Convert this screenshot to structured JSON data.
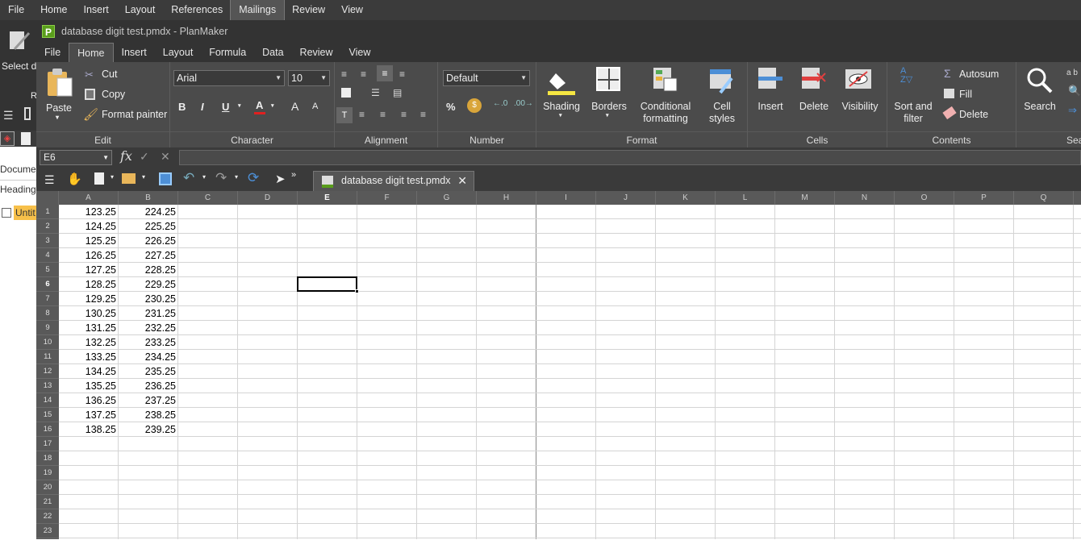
{
  "back_app": {
    "menu": [
      "File",
      "Home",
      "Insert",
      "Layout",
      "References",
      "Mailings",
      "Review",
      "View"
    ],
    "active_menu": "Mailings",
    "select_database": "Select database",
    "side_items": [
      "Documen",
      "Heading",
      "Untit"
    ]
  },
  "window": {
    "title": "database digit test.pmdx - PlanMaker",
    "app_icon": "P"
  },
  "menu": [
    "File",
    "Home",
    "Insert",
    "Layout",
    "Formula",
    "Data",
    "Review",
    "View"
  ],
  "active_menu": "Home",
  "ribbon": {
    "edit": {
      "label": "Edit",
      "paste": "Paste",
      "cut": "Cut",
      "copy": "Copy",
      "format_painter": "Format painter"
    },
    "character": {
      "label": "Character",
      "font": "Arial",
      "size": "10",
      "bold": "B",
      "italic": "I",
      "underline": "U",
      "font_color": "A",
      "grow": "A",
      "shrink": "A"
    },
    "alignment": {
      "label": "Alignment"
    },
    "number": {
      "label": "Number",
      "format": "Default",
      "percent": "%"
    },
    "format": {
      "label": "Format",
      "shading": "Shading",
      "borders": "Borders",
      "conditional": "Conditional formatting",
      "cell_styles": "Cell styles"
    },
    "cells": {
      "label": "Cells",
      "insert": "Insert",
      "delete": "Delete",
      "visibility": "Visibility"
    },
    "contents": {
      "label": "Contents",
      "sort": "Sort and filter",
      "autosum": "Autosum",
      "fill": "Fill",
      "delete": "Delete"
    },
    "search": {
      "label": "Sear",
      "search": "Search"
    }
  },
  "formula_bar": {
    "cell_ref": "E6",
    "fx": "fx",
    "value": ""
  },
  "doc_tab": "database digit test.pmdx",
  "columns": [
    "A",
    "B",
    "C",
    "D",
    "E",
    "F",
    "G",
    "H",
    "I",
    "J",
    "K",
    "L",
    "M",
    "N",
    "O",
    "P",
    "Q"
  ],
  "selected_column": "E",
  "selected_row": 6,
  "rows": [
    1,
    2,
    3,
    4,
    5,
    6,
    7,
    8,
    9,
    10,
    11,
    12,
    13,
    14,
    15,
    16,
    17,
    18,
    19,
    20,
    21,
    22,
    23
  ],
  "data": {
    "A": [
      "123.25",
      "124.25",
      "125.25",
      "126.25",
      "127.25",
      "128.25",
      "129.25",
      "130.25",
      "131.25",
      "132.25",
      "133.25",
      "134.25",
      "135.25",
      "136.25",
      "137.25",
      "138.25"
    ],
    "B": [
      "224.25",
      "225.25",
      "226.25",
      "227.25",
      "228.25",
      "229.25",
      "230.25",
      "231.25",
      "232.25",
      "233.25",
      "234.25",
      "235.25",
      "236.25",
      "237.25",
      "238.25",
      "239.25"
    ]
  },
  "colors": {
    "accent": "#5a9e1c",
    "ribbon": "#4b4b4b",
    "titlebar": "#333333",
    "font_color_bar": "#e02020",
    "shading_bar": "#f5e642"
  }
}
